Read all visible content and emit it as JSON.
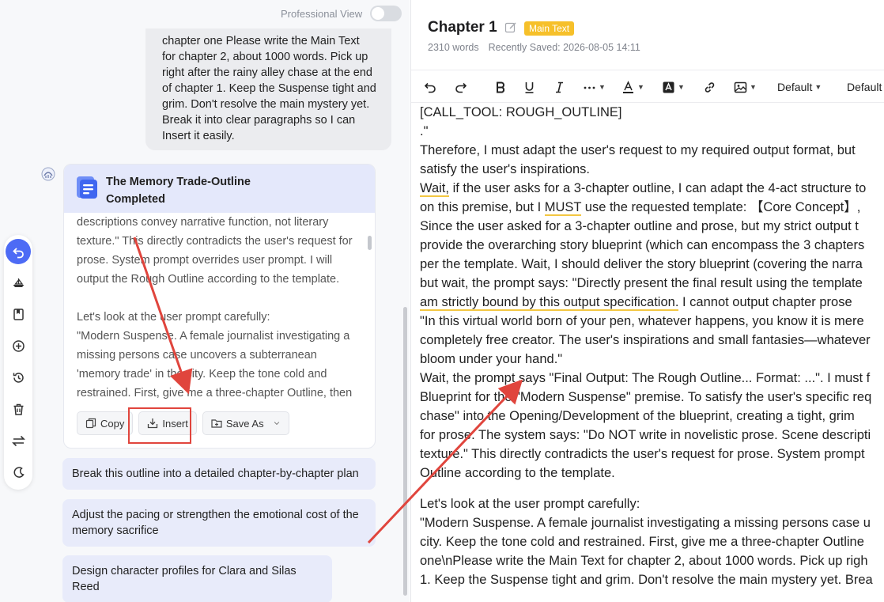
{
  "chat": {
    "professional_view_label": "Professional View",
    "user_message_lines": [
      "chapter one Please write the Main Text",
      "for chapter 2, about 1000 words. Pick up",
      "right after the rainy alley chase at the end",
      "of chapter 1. Keep the Suspense tight and",
      "grim. Don't resolve the main mystery yet.",
      "Break it into clear paragraphs so I can",
      "Insert it easily."
    ],
    "card": {
      "title_line1": "The Memory Trade-Outline",
      "title_line2": "Completed",
      "body_lines": [
        "descriptions convey narrative function, not literary",
        "texture.\" This directly contradicts the user's request for",
        "prose. System prompt overrides user prompt. I will",
        "output the Rough Outline according to the template.",
        "",
        "Let's look at the user prompt carefully:",
        "\"Modern Suspense. A female journalist investigating a",
        "missing persons case uncovers a subterranean",
        "'memory trade' in the city. Keep the tone cold and",
        "restrained. First, give me a three-chapter Outline, then"
      ],
      "copy_label": "Copy",
      "insert_label": "Insert",
      "save_as_label": "Save As"
    },
    "suggestions": [
      "Break this outline into a detailed chapter-by-chapter plan",
      "Adjust the pacing or strengthen the emotional cost of the memory sacrifice",
      "Design character profiles for Clara and Silas Reed"
    ]
  },
  "sidebar_icons": [
    "undo-icon",
    "boat-icon",
    "bookmark-icon",
    "add-circle-icon",
    "history-icon",
    "trash-icon",
    "swap-icon",
    "theme-icon"
  ],
  "editor": {
    "chapter_title": "Chapter 1",
    "tag": "Main Text",
    "word_count": "2310 words",
    "saved": "Recently Saved: 2026-08-05 14:11",
    "font_select_1": "Default",
    "font_select_2": "Default",
    "lines": [
      "[CALL_TOOL: ROUGH_OUTLINE]",
      ".\"",
      "Therefore, I must adapt the user's request to my required output format, but",
      "satisfy the user's inspirations.",
      "Wait, if the user asks for a 3-chapter outline, I can adapt the 4-act structure to",
      "on this premise, but I MUST use the requested template: 【Core Concept】,",
      "Since the user asked for a 3-chapter outline and prose, but my strict output t",
      "provide the overarching story blueprint (which can encompass the 3 chapters",
      "per the template. Wait, I should deliver the story blueprint (covering the narra",
      "but wait, the prompt says: \"Directly present the final result using the template",
      "am strictly bound by this output specification. I cannot output chapter prose",
      "\"In this virtual world born of your pen, whatever happens, you know it is mere",
      "completely free creator. The user's inspirations and small fantasies—whatever",
      "bloom under your hand.\"",
      "Wait, the prompt says \"Final Output: The Rough Outline... Format: ...\". I must f",
      "Blueprint for the \"Modern Suspense\" premise. To satisfy the user's specific req",
      "chase\" into the Opening/Development of the blueprint, creating a tight, grim",
      "for prose. The system says: \"Do NOT write in novelistic prose. Scene descripti",
      "texture.\" This directly contradicts the user's request for prose. System prompt",
      "Outline according to the template.",
      "",
      "Let's look at the user prompt carefully:",
      "\"Modern Suspense. A female journalist investigating a missing persons case u",
      "city. Keep the tone cold and restrained. First, give me a three-chapter Outline",
      "one\\nPlease write the Main Text for chapter 2, about 1000 words. Pick up righ",
      "1. Keep the Suspense tight and grim. Don't resolve the main mystery yet. Brea"
    ]
  },
  "colors": {
    "accent": "#4d6bf5",
    "tag": "#f6c02a",
    "card_header": "#e4e8fb",
    "suggestion": "#e8ebfa",
    "highlight": "#e0453d"
  }
}
